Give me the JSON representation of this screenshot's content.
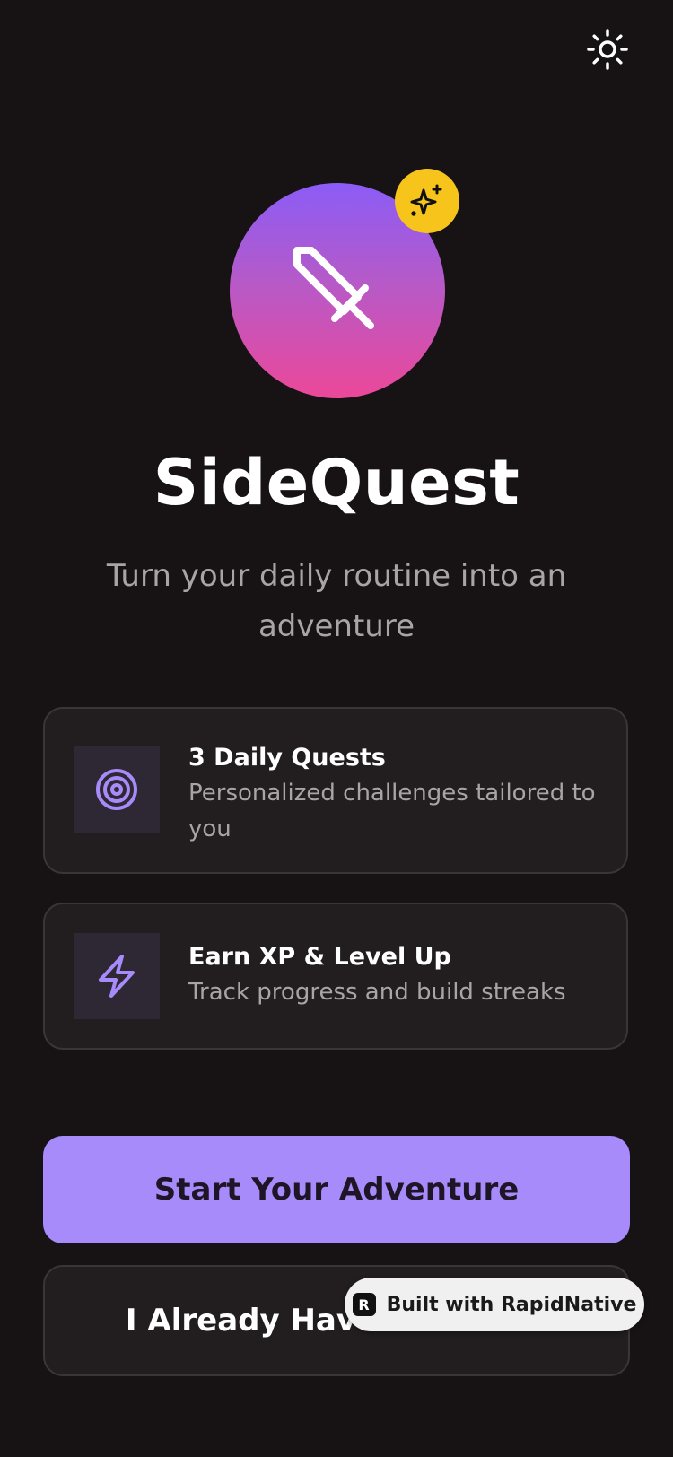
{
  "header": {
    "theme_toggle_icon": "sun-icon"
  },
  "hero": {
    "main_icon": "sword-icon",
    "badge_icon": "sparkles-icon",
    "gradient_top": "#8b5cf6",
    "gradient_bottom": "#ec4899",
    "badge_color": "#f7c41b"
  },
  "app": {
    "title": "SideQuest",
    "tagline": "Turn your daily routine into an adventure"
  },
  "features": [
    {
      "icon": "target-icon",
      "title": "3 Daily Quests",
      "description": "Personalized challenges tailored to you"
    },
    {
      "icon": "lightning-bolt-icon",
      "title": "Earn XP & Level Up",
      "description": "Track progress and build streaks"
    }
  ],
  "actions": {
    "primary_label": "Start Your Adventure",
    "secondary_label": "I Already Have"
  },
  "badge": {
    "logo_letter": "R",
    "label": "Built with RapidNative"
  },
  "colors": {
    "background": "#171314",
    "accent": "#a78bfa",
    "card_background": "#221e1f",
    "icon_accent": "#a78bfa"
  }
}
